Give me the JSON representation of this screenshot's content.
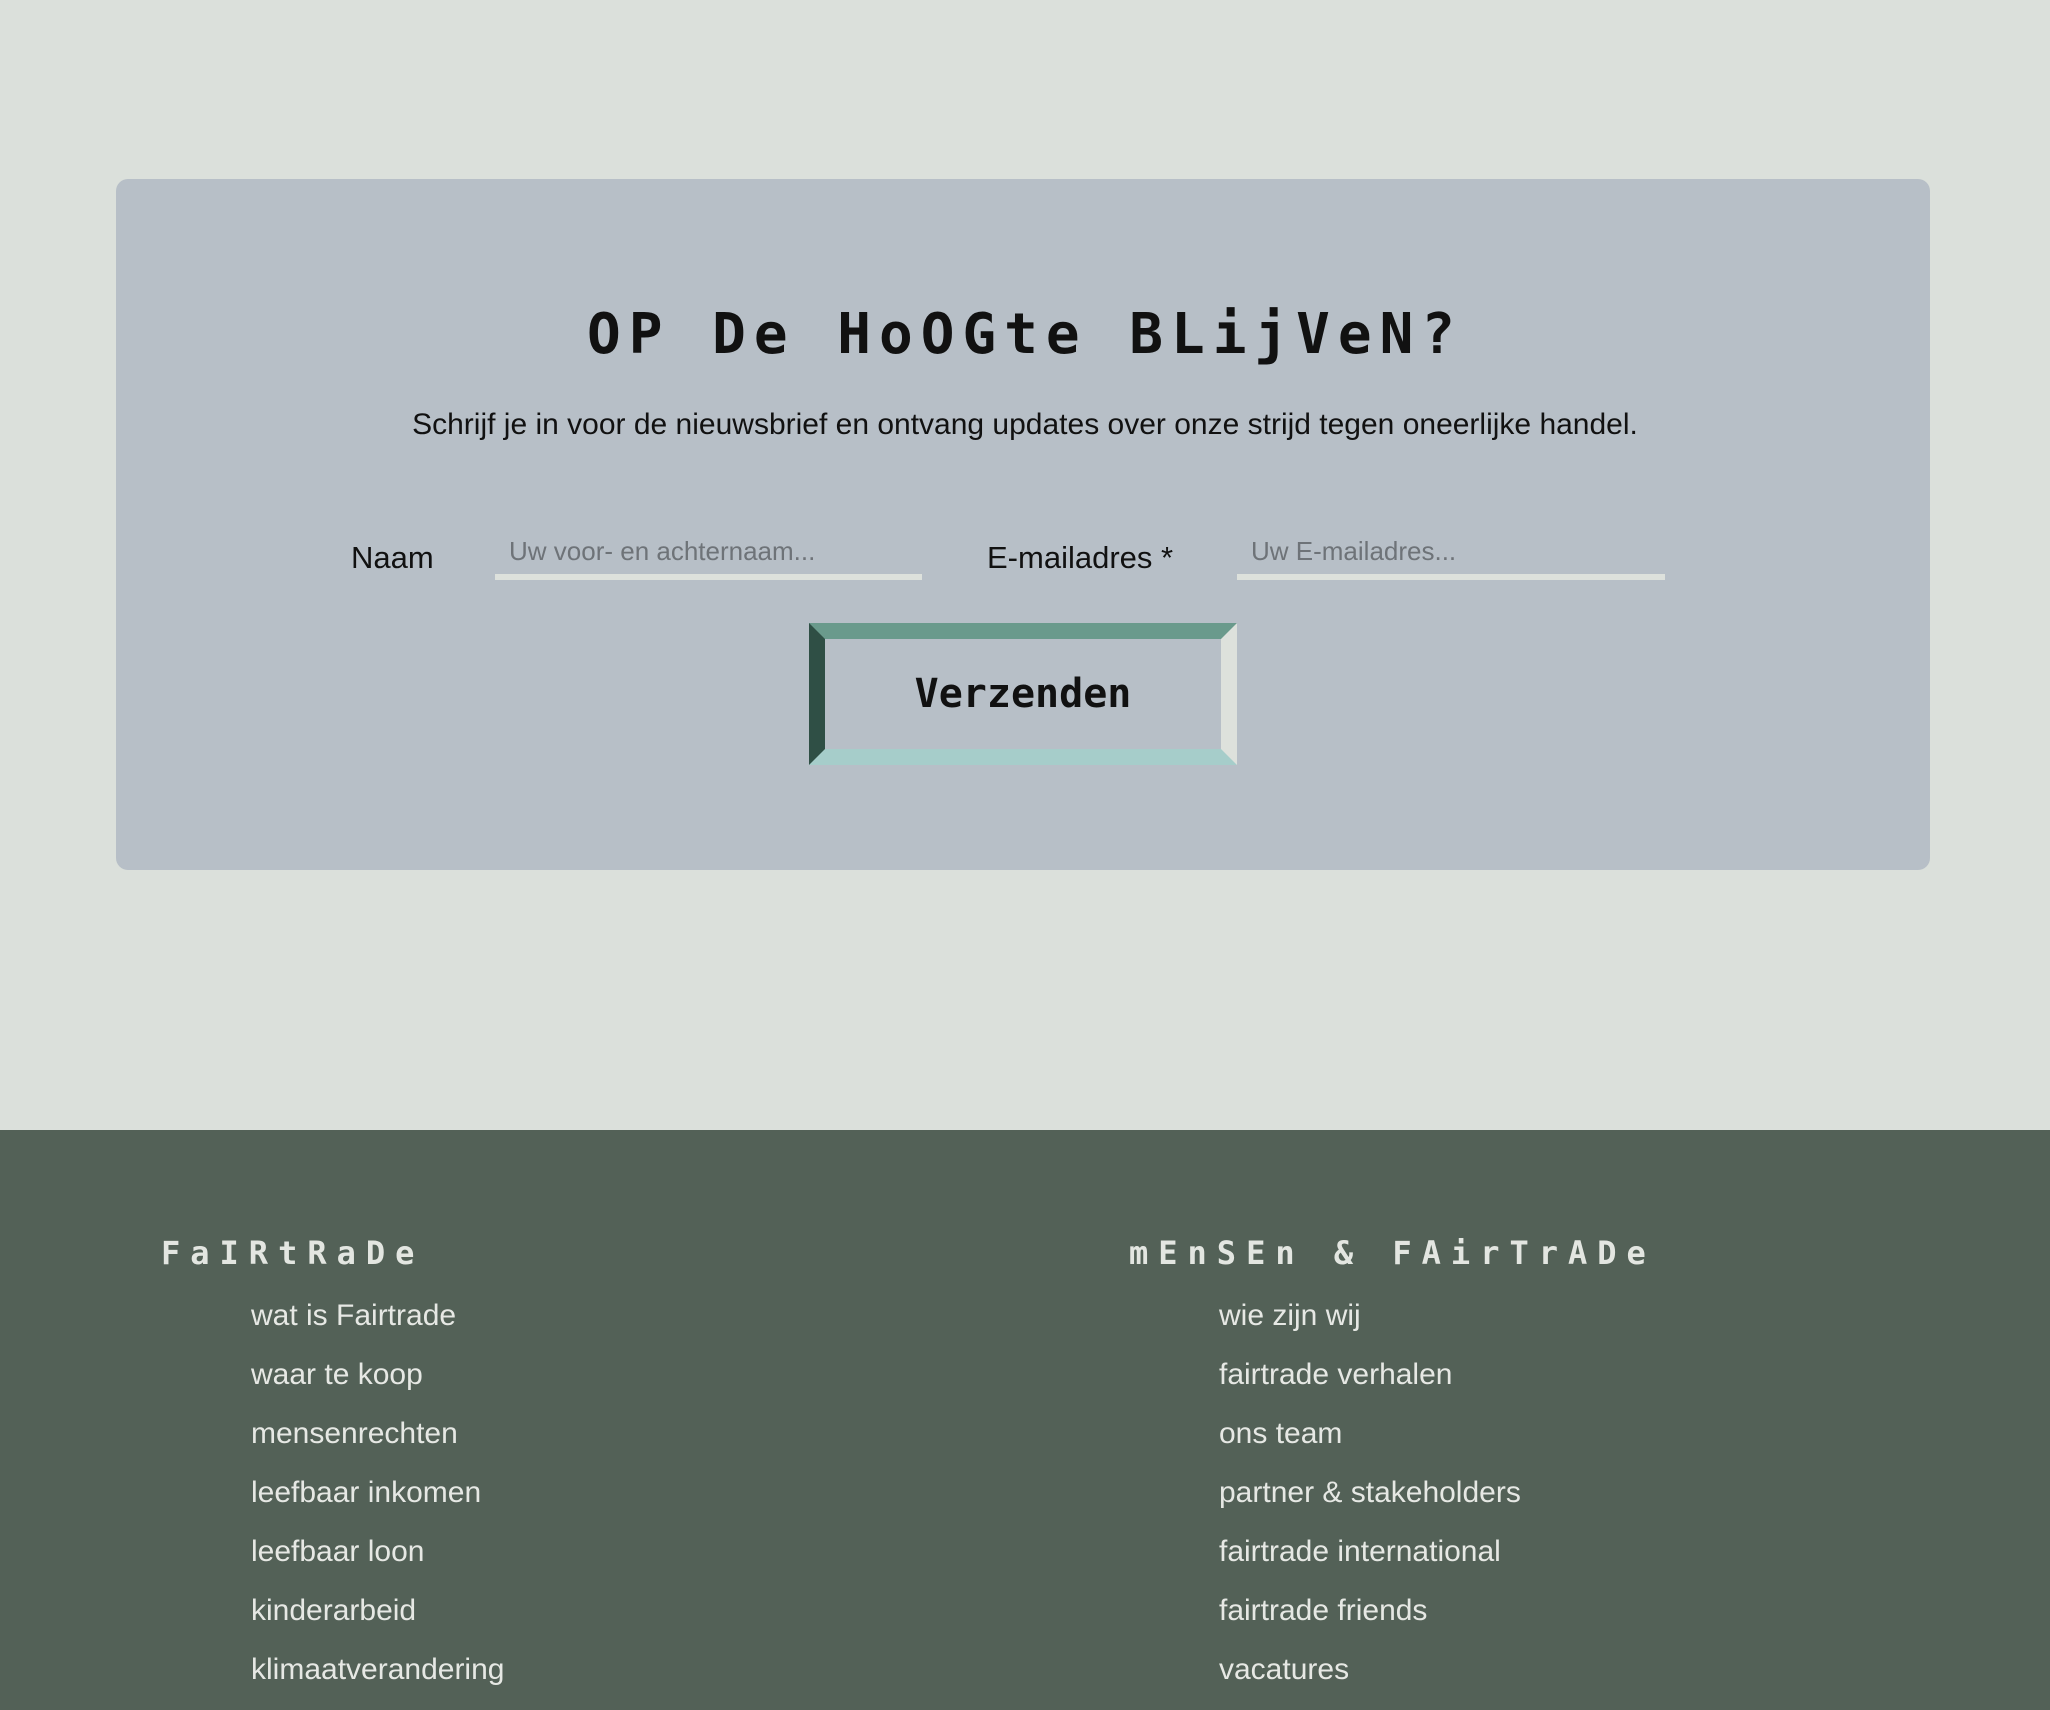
{
  "newsletter": {
    "title": "OP De HoOGte BLijVeN?",
    "subtitle": "Schrijf je in voor de nieuwsbrief en ontvang updates over onze strijd tegen oneerlijke handel.",
    "name_label": "Naam",
    "name_placeholder": "Uw voor- en achternaam...",
    "email_label": "E-mailadres *",
    "email_placeholder": "Uw E-mailadres...",
    "submit_label": "Verzenden"
  },
  "footer": {
    "columns": [
      {
        "heading": "FaIRtRaDe",
        "links": [
          "wat is Fairtrade",
          "waar te koop",
          "mensenrechten",
          "leefbaar inkomen",
          "leefbaar loon",
          "kinderarbeid",
          "klimaatverandering"
        ]
      },
      {
        "heading": "mEnSEn & FAirTrADe",
        "links": [
          "wie zijn wij",
          "fairtrade verhalen",
          "ons team",
          "partner & stakeholders",
          "fairtrade international",
          "fairtrade friends",
          "vacatures"
        ]
      }
    ]
  },
  "colors": {
    "page_background": "#dbe0db",
    "card_background": "#b7bfc7",
    "footer_background": "#536157",
    "button_border_top": "#6a9a8c",
    "button_border_left": "#2f4f45",
    "button_border_right": "#dde1dc",
    "button_border_bottom": "#a6cdca"
  }
}
